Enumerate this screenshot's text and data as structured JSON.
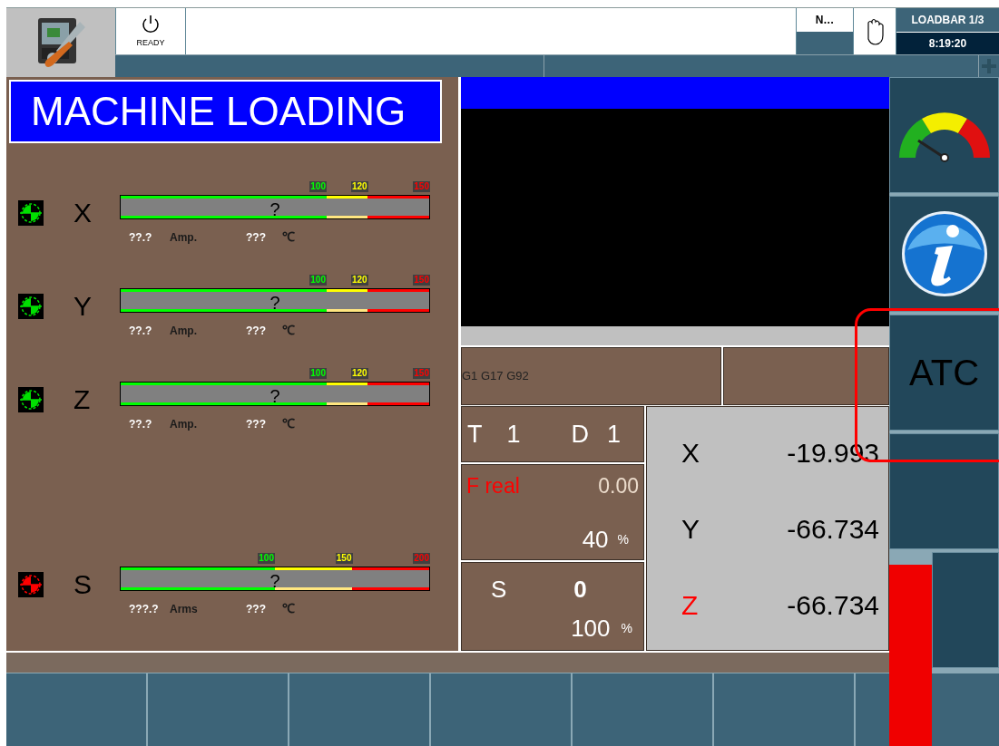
{
  "header": {
    "status": "READY",
    "mode": "N…",
    "channel": "LOADBAR 1/3",
    "time": "8:19:20"
  },
  "title": "MACHINE LOADING",
  "axes": [
    {
      "name": "X",
      "color": "#00e000",
      "value": "?",
      "current": "??.?",
      "current_unit": "Amp.",
      "temperature": "???",
      "temperature_unit": "℃",
      "ticks": [
        {
          "label": "100",
          "color": "#00ff00"
        },
        {
          "label": "120",
          "color": "#ffff00"
        },
        {
          "label": "150",
          "color": "#ff0000"
        }
      ]
    },
    {
      "name": "Y",
      "color": "#00e000",
      "value": "?",
      "current": "??.?",
      "current_unit": "Amp.",
      "temperature": "???",
      "temperature_unit": "℃",
      "ticks": [
        {
          "label": "100",
          "color": "#00ff00"
        },
        {
          "label": "120",
          "color": "#ffff00"
        },
        {
          "label": "150",
          "color": "#ff0000"
        }
      ]
    },
    {
      "name": "Z",
      "color": "#00e000",
      "value": "?",
      "current": "??.?",
      "current_unit": "Amp.",
      "temperature": "???",
      "temperature_unit": "℃",
      "ticks": [
        {
          "label": "100",
          "color": "#00ff00"
        },
        {
          "label": "120",
          "color": "#ffff00"
        },
        {
          "label": "150",
          "color": "#ff0000"
        }
      ]
    }
  ],
  "spindle_load": {
    "name": "S",
    "color": "#ff0000",
    "value": "?",
    "current": "???.?",
    "current_unit": "Arms",
    "temperature": "???",
    "temperature_unit": "℃",
    "ticks": [
      {
        "label": "100",
        "color": "#00ff00"
      },
      {
        "label": "150",
        "color": "#ffff00"
      },
      {
        "label": "200",
        "color": "#ff0000"
      }
    ]
  },
  "program_line": "G1 G17 G92",
  "tool": {
    "tool_label": "T",
    "tool_value": "1",
    "offset_label": "D",
    "offset_value": "1"
  },
  "feed": {
    "label": "F real",
    "value": "0.00",
    "override": "40",
    "unit": "%"
  },
  "spindle": {
    "label": "S",
    "value": "0",
    "override": "100",
    "unit": "%"
  },
  "coordinates": [
    {
      "axis": "X",
      "value": "-19.993",
      "alarm": false
    },
    {
      "axis": "Y",
      "value": "-66.734",
      "alarm": false
    },
    {
      "axis": "Z",
      "value": "-66.734",
      "alarm": true
    }
  ],
  "sidebar": [
    {
      "kind": "gauge"
    },
    {
      "kind": "info"
    },
    {
      "kind": "text",
      "label": "ATC"
    },
    {
      "kind": "blank"
    },
    {
      "kind": "blank"
    }
  ]
}
